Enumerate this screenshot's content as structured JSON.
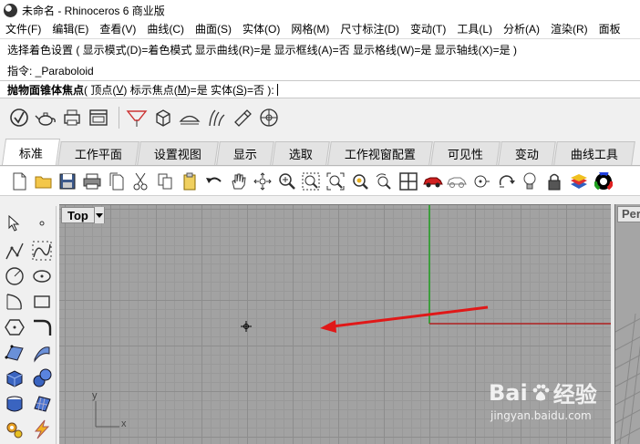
{
  "window": {
    "title": "未命名 - Rhinoceros 6 商业版"
  },
  "menu": [
    "文件(F)",
    "编辑(E)",
    "查看(V)",
    "曲线(C)",
    "曲面(S)",
    "实体(O)",
    "网格(M)",
    "尺寸标注(D)",
    "变动(T)",
    "工具(L)",
    "分析(A)",
    "渲染(R)",
    "面板"
  ],
  "command_history": [
    "选择着色设置 ( 显示模式(D)=着色模式  显示曲线(R)=是  显示框线(A)=否  显示格线(W)=是  显示轴线(X)=是 )",
    "指令: _Paraboloid"
  ],
  "command_prompt": {
    "label": "抛物面锥体焦点",
    "open": " ( 顶点(",
    "opt1_key": "V",
    "opt1_mid": ")  标示焦点(",
    "opt2_key": "M",
    "opt2_mid": ")=是  实体(",
    "opt3_key": "S",
    "opt3_end": ")=否 ):"
  },
  "tabs": [
    {
      "label": "标准",
      "active": true
    },
    {
      "label": "工作平面",
      "active": false
    },
    {
      "label": "设置视图",
      "active": false
    },
    {
      "label": "显示",
      "active": false
    },
    {
      "label": "选取",
      "active": false
    },
    {
      "label": "工作视窗配置",
      "active": false
    },
    {
      "label": "可见性",
      "active": false
    },
    {
      "label": "变动",
      "active": false
    },
    {
      "label": "曲线工具",
      "active": false
    }
  ],
  "viewport_top": {
    "name": "Top",
    "axis_x": "x",
    "axis_y": "y"
  },
  "viewport_persp": {
    "name": "Per"
  },
  "colors": {
    "x_axis": "#b02020",
    "y_axis": "#20a020",
    "arrow": "#e01818"
  },
  "watermark": {
    "brand_left": "Bai",
    "brand_right": "经验",
    "url": "jingyan.baidu.com"
  }
}
